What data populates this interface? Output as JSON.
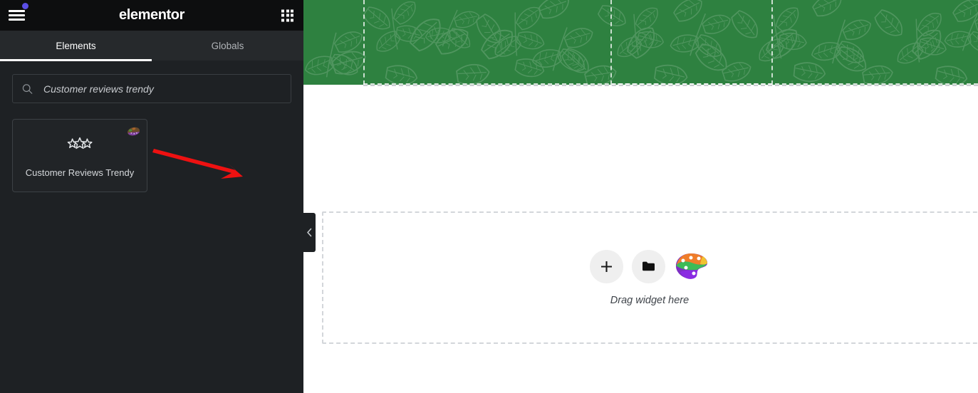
{
  "panel": {
    "brand": "elementor",
    "menu_icon": "hamburger-menu-icon",
    "apps_icon": "apps-grid-icon",
    "tabs": [
      {
        "label": "Elements",
        "active": true
      },
      {
        "label": "Globals",
        "active": false
      }
    ],
    "search": {
      "value": "Customer reviews trendy",
      "placeholder": "Search Widget...",
      "icon": "search-icon"
    },
    "widgets": [
      {
        "label": "Customer Reviews Trendy",
        "icon": "three-stars-icon",
        "badge": "palette-badge-icon"
      }
    ],
    "collapse_handle_icon": "chevron-left-icon"
  },
  "canvas": {
    "hero": {
      "background_color": "#2e8140",
      "pattern": "leaf-pattern"
    },
    "dropzone": {
      "text": "Drag widget here",
      "add_button_icon": "plus-icon",
      "folder_button_icon": "folder-icon",
      "palette_button_icon": "color-palette-icon"
    }
  },
  "annotation": {
    "arrow": "red-pointer-arrow",
    "color": "#ee1111"
  }
}
